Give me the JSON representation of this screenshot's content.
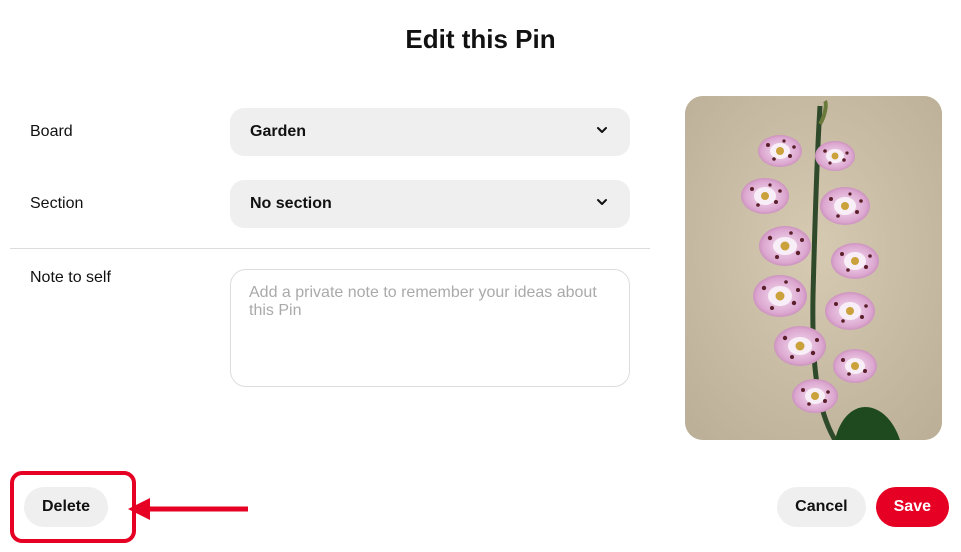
{
  "title": "Edit this Pin",
  "fields": {
    "board": {
      "label": "Board",
      "value": "Garden"
    },
    "section": {
      "label": "Section",
      "value": "No section"
    },
    "note": {
      "label": "Note to self",
      "placeholder": "Add a private note to remember your ideas about this Pin"
    }
  },
  "buttons": {
    "delete": "Delete",
    "cancel": "Cancel",
    "save": "Save"
  },
  "annotation": {
    "highlight_color": "#e60023"
  }
}
